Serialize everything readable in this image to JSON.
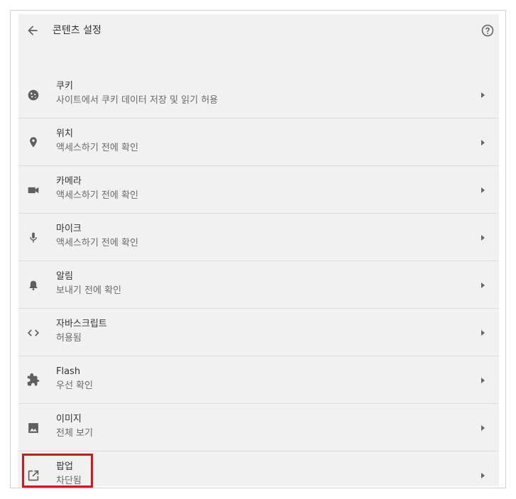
{
  "header": {
    "title": "콘텐츠 설정",
    "back_icon": "arrow-back-icon",
    "help_icon": "help-circle-icon"
  },
  "items": [
    {
      "title": "쿠키",
      "subtitle": "사이트에서 쿠키 데이터 저장 및 읽기 허용",
      "icon": "cookie-icon"
    },
    {
      "title": "위치",
      "subtitle": "액세스하기 전에 확인",
      "icon": "location-pin-icon"
    },
    {
      "title": "카메라",
      "subtitle": "액세스하기 전에 확인",
      "icon": "camera-icon"
    },
    {
      "title": "마이크",
      "subtitle": "액세스하기 전에 확인",
      "icon": "microphone-icon"
    },
    {
      "title": "알림",
      "subtitle": "보내기 전에 확인",
      "icon": "bell-icon"
    },
    {
      "title": "자바스크립트",
      "subtitle": "허용됨",
      "icon": "code-brackets-icon"
    },
    {
      "title": "Flash",
      "subtitle": "우선 확인",
      "icon": "puzzle-icon"
    },
    {
      "title": "이미지",
      "subtitle": "전체 보기",
      "icon": "image-icon"
    },
    {
      "title": "팝업",
      "subtitle": "차단됨",
      "icon": "open-in-new-icon"
    }
  ],
  "colors": {
    "panel_bg": "#f1f1f1",
    "divider": "#dcdcdc",
    "highlight": "#e0111b",
    "icon": "#5f5f5f"
  }
}
